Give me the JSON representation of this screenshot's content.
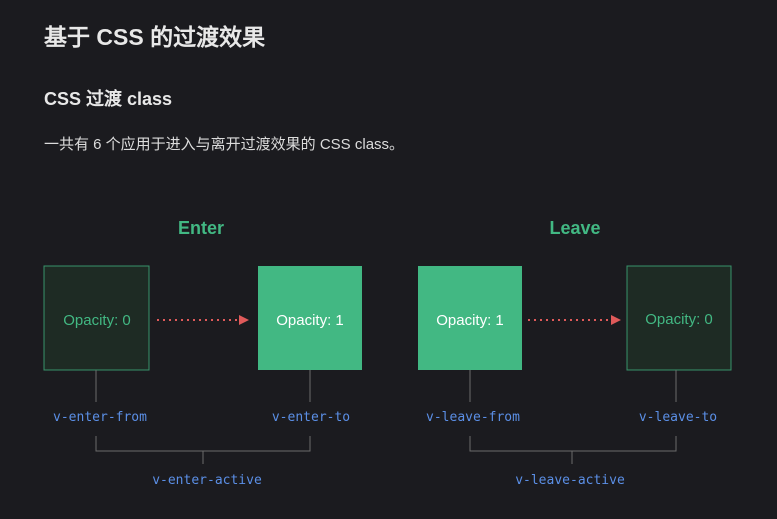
{
  "page": {
    "title": "基于 CSS 的过渡效果",
    "section_title": "CSS 过渡 class",
    "description": "一共有 6 个应用于进入与离开过渡效果的 CSS class。"
  },
  "diagram": {
    "colors": {
      "accent": "#42b883",
      "dark_box_fill": "#1e2b24",
      "class_label": "#5b8fe6",
      "arrow": "#e05a5a",
      "connector": "#6b6b6b"
    },
    "enter": {
      "heading": "Enter",
      "from_box": "Opacity: 0",
      "to_box": "Opacity: 1",
      "from_class": "v-enter-from",
      "to_class": "v-enter-to",
      "active_class": "v-enter-active"
    },
    "leave": {
      "heading": "Leave",
      "from_box": "Opacity: 1",
      "to_box": "Opacity: 0",
      "from_class": "v-leave-from",
      "to_class": "v-leave-to",
      "active_class": "v-leave-active"
    }
  }
}
